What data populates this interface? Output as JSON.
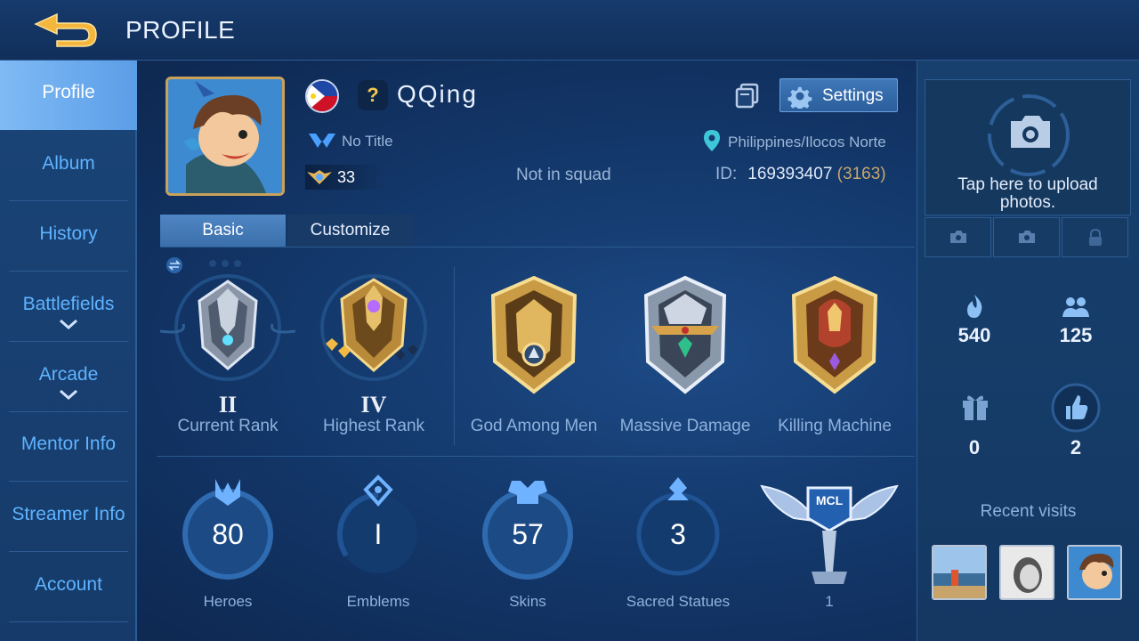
{
  "header": {
    "title": "PROFILE",
    "back_icon": "back-arrow-icon"
  },
  "sidebar": {
    "items": [
      {
        "label": "Profile",
        "active": true
      },
      {
        "label": "Album"
      },
      {
        "label": "History"
      },
      {
        "label": "Battlefields",
        "expandable": true
      },
      {
        "label": "Arcade",
        "expandable": true
      },
      {
        "label": "Mentor Info"
      },
      {
        "label": "Streamer Info"
      },
      {
        "label": "Account"
      }
    ]
  },
  "profile": {
    "username": "QQing",
    "title": "No Title",
    "level": "33",
    "squad": "Not in squad",
    "location": "Philippines/Ilocos Norte",
    "id_label": "ID:",
    "id": "169393407",
    "server": "(3163)",
    "settings_label": "Settings",
    "unknown_badge": "?"
  },
  "tabs": [
    {
      "label": "Basic",
      "active": true
    },
    {
      "label": "Customize"
    }
  ],
  "ranks": [
    {
      "numeral": "II",
      "label": "Current Rank"
    },
    {
      "numeral": "IV",
      "label": "Highest Rank"
    }
  ],
  "badges": [
    {
      "label": "God Among Men"
    },
    {
      "label": "Massive Damage"
    },
    {
      "label": "Killing Machine"
    }
  ],
  "stats": [
    {
      "value": "80",
      "label": "Heroes"
    },
    {
      "value": "I",
      "label": "Emblems"
    },
    {
      "value": "57",
      "label": "Skins"
    },
    {
      "value": "3",
      "label": "Sacred Statues"
    }
  ],
  "mcl": {
    "emblem_text": "MCL",
    "count": "1"
  },
  "right": {
    "upload_text": "Tap here to upload photos.",
    "popularity": "540",
    "followers": "125",
    "gifts": "0",
    "likes": "2",
    "recent_visits_label": "Recent visits"
  },
  "colors": {
    "accent": "#5fb3ff",
    "gold": "#c9a15a",
    "panel": "#143a6e"
  }
}
